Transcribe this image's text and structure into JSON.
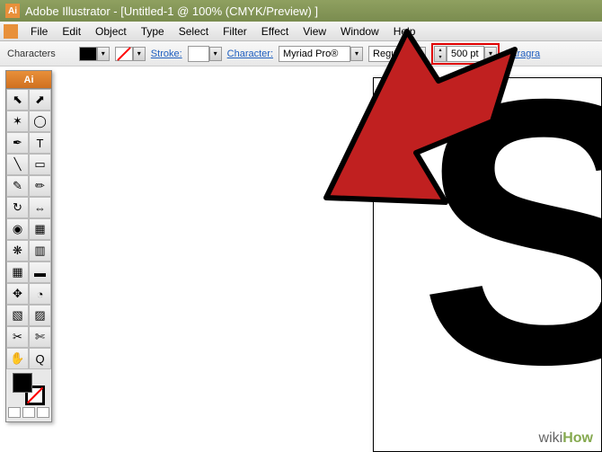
{
  "titlebar": {
    "text": "Adobe Illustrator - [Untitled-1 @ 100% (CMYK/Preview) ]"
  },
  "menubar": {
    "items": [
      "File",
      "Edit",
      "Object",
      "Type",
      "Select",
      "Filter",
      "Effect",
      "View",
      "Window",
      "Help"
    ]
  },
  "toolbar": {
    "characters_label": "Characters",
    "stroke_label": "Stroke:",
    "stroke_value": "",
    "character_label": "Character:",
    "font": "Myriad Pro®",
    "weight": "Regular",
    "size": "500 pt",
    "paragraph_label": "Paragra"
  },
  "tool_panel": {
    "header": "Ai",
    "tools": [
      "▲",
      "✶",
      "✒",
      "T",
      "╱",
      "□",
      "✎",
      "◐",
      "✂",
      "↻",
      "◉",
      "▦",
      "◔",
      "▭",
      "✥",
      "Q",
      "↔",
      "✋",
      "⤢",
      "⊡",
      "⊞",
      "◫"
    ]
  },
  "canvas": {
    "letter": "S"
  },
  "watermark": {
    "wiki": "wiki",
    "how": "How"
  }
}
